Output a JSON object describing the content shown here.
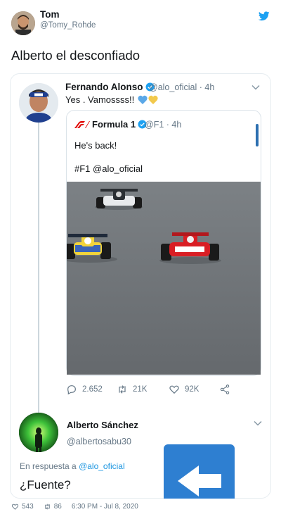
{
  "tweet": {
    "author_name": "Tom",
    "author_handle": "@Tomy_Rohde",
    "text": "Alberto el desconfiado"
  },
  "quoted": {
    "author_name": "Fernando Alonso",
    "author_handle": "@alo_oficial · 4h",
    "text": "Yes . Vamossss!!",
    "inner": {
      "author_name": "Formula 1",
      "author_handle": "@F1 · 4h",
      "line1": "He's back!",
      "line2": "#F1 @alo_oficial"
    },
    "actions": {
      "replies": "2.652",
      "retweets": "21K",
      "likes": "92K"
    }
  },
  "reply": {
    "author_name": "Alberto Sánchez",
    "author_handle": "@albertosabu30",
    "reply_prefix": "En respuesta a",
    "reply_mention": "@alo_oficial",
    "text": "¿Fuente?"
  },
  "footer": {
    "likes": "543",
    "retweets": "86",
    "timestamp": "6:30 PM - Jul 8, 2020"
  },
  "colors": {
    "twitter_blue": "#1da1f2",
    "mention_blue": "#1b95e0",
    "muted_text": "#657786",
    "border": "#e6ecf0"
  },
  "icons": [
    "twitter-bird-icon",
    "verified-badge-icon",
    "chevron-down-icon",
    "reply-icon",
    "retweet-icon",
    "heart-icon",
    "share-icon",
    "formula1-logo-icon",
    "back-arrow-icon"
  ]
}
